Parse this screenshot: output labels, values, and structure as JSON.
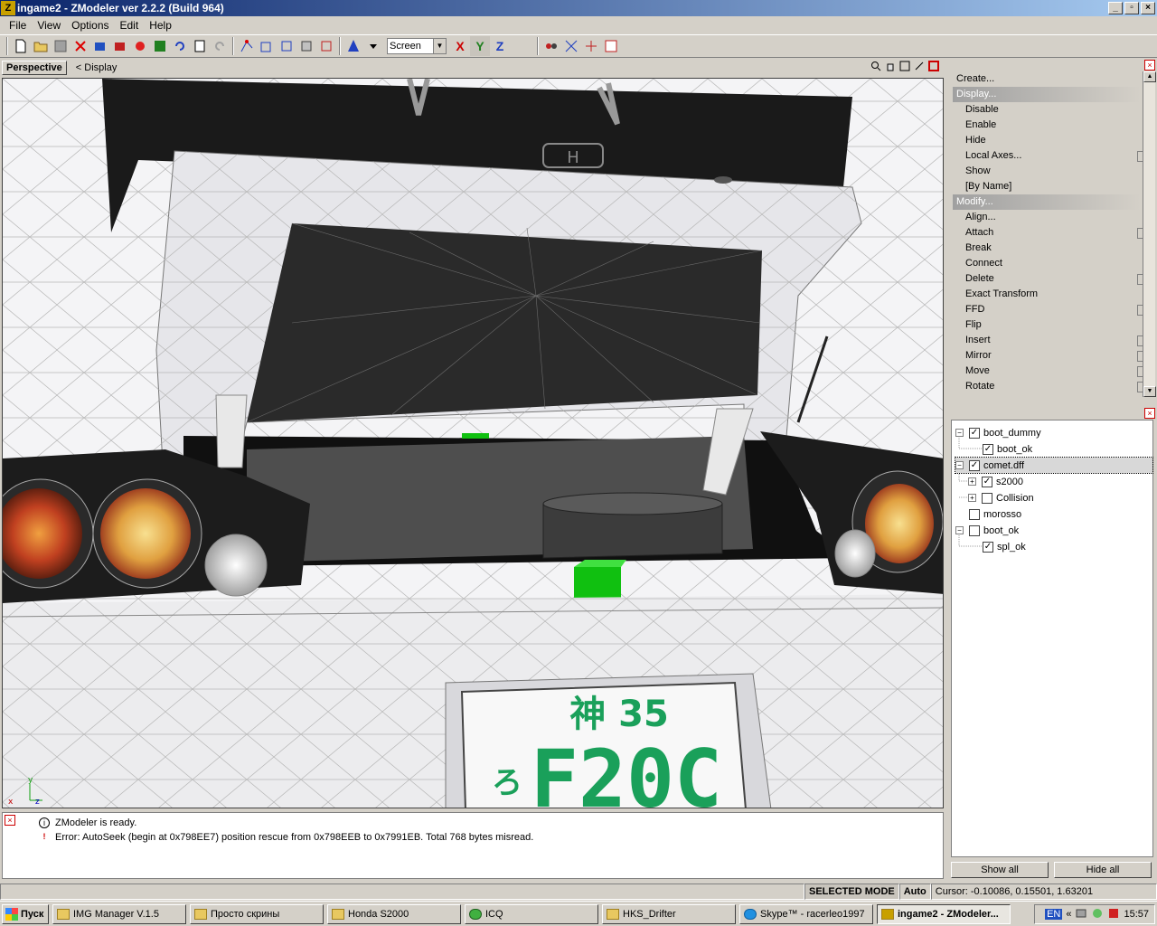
{
  "window": {
    "title": "ingame2 - ZModeler ver 2.2.2 (Build 964)",
    "app_icon": "Z",
    "min": "_",
    "max": "▫",
    "close": "×"
  },
  "menu": [
    "File",
    "View",
    "Options",
    "Edit",
    "Help"
  ],
  "toolbar": {
    "coord_select": "Screen",
    "axis_x": "X",
    "axis_y": "Y",
    "axis_z": "Z"
  },
  "viewport": {
    "tab": "Perspective",
    "mode": "< Display",
    "plate_kanji": "神 35",
    "plate_kana": "ろ",
    "plate_text": "F20C",
    "axis_y": "y",
    "axis_x": "x",
    "axis_z": "z"
  },
  "commands": {
    "create": "Create...",
    "display_head": "Display...",
    "display_items": [
      "Disable",
      "Enable",
      "Hide",
      "Local Axes...",
      "Show",
      "[By Name]"
    ],
    "modify_head": "Modify...",
    "modify_items": [
      "Align...",
      "Attach",
      "Break",
      "Connect",
      "Delete",
      "Exact Transform",
      "FFD",
      "Flip",
      "Insert",
      "Mirror",
      "Move",
      "Rotate"
    ]
  },
  "tree": [
    {
      "label": "boot_dummy",
      "checked": "✓"
    },
    {
      "label": "boot_ok",
      "checked": "✓"
    },
    {
      "label": "comet.dff",
      "checked": "✓"
    },
    {
      "label": "s2000",
      "checked": "✓"
    },
    {
      "label": "Collision",
      "checked": ""
    },
    {
      "label": "morosso",
      "checked": ""
    },
    {
      "label": "boot_ok",
      "checked": ""
    },
    {
      "label": "spl_ok",
      "checked": "✓"
    }
  ],
  "tree_buttons": {
    "show_all": "Show all",
    "hide_all": "Hide all"
  },
  "log": [
    {
      "icon": "i",
      "text": "ZModeler is ready."
    },
    {
      "icon": "!",
      "text": "Error: AutoSeek (begin at 0x798EE7) position rescue  from 0x798EEB to 0x7991EB. Total 768 bytes misread."
    }
  ],
  "status": {
    "mode": "SELECTED MODE",
    "auto": "Auto",
    "cursor": "Cursor: -0.10086, 0.15501, 1.63201"
  },
  "taskbar": {
    "start": "Пуск",
    "tasks": [
      "IMG Manager V.1.5",
      "Просто скрины",
      "Honda S2000",
      "ICQ",
      "HKS_Drifter",
      "Skype™ - racerleo1997",
      "ingame2 - ZModeler..."
    ],
    "lang": "EN",
    "chevron": "«",
    "clock": "15:57"
  },
  "colors": {
    "title_start": "#0a246a",
    "title_end": "#a6caf0",
    "plate_green": "#1aa05a",
    "gizmo_green": "#10c010"
  }
}
